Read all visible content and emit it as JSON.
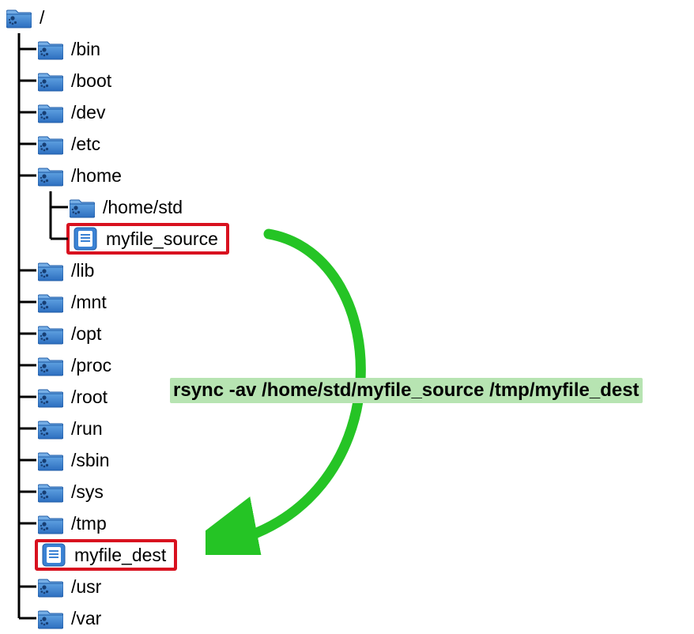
{
  "tree": {
    "root": "/",
    "bin": "/bin",
    "boot": "/boot",
    "dev": "/dev",
    "etc": "/etc",
    "home": "/home",
    "home_std": "/home/std",
    "myfile_source": "myfile_source",
    "lib": "/lib",
    "mnt": "/mnt",
    "opt": "/opt",
    "proc": "/proc",
    "root_dir": "/root",
    "run": "/run",
    "sbin": "/sbin",
    "sys": "/sys",
    "tmp": "/tmp",
    "myfile_dest": "myfile_dest",
    "usr": "/usr",
    "var": "/var"
  },
  "command": "rsync -av /home/std/myfile_source /tmp/myfile_dest"
}
